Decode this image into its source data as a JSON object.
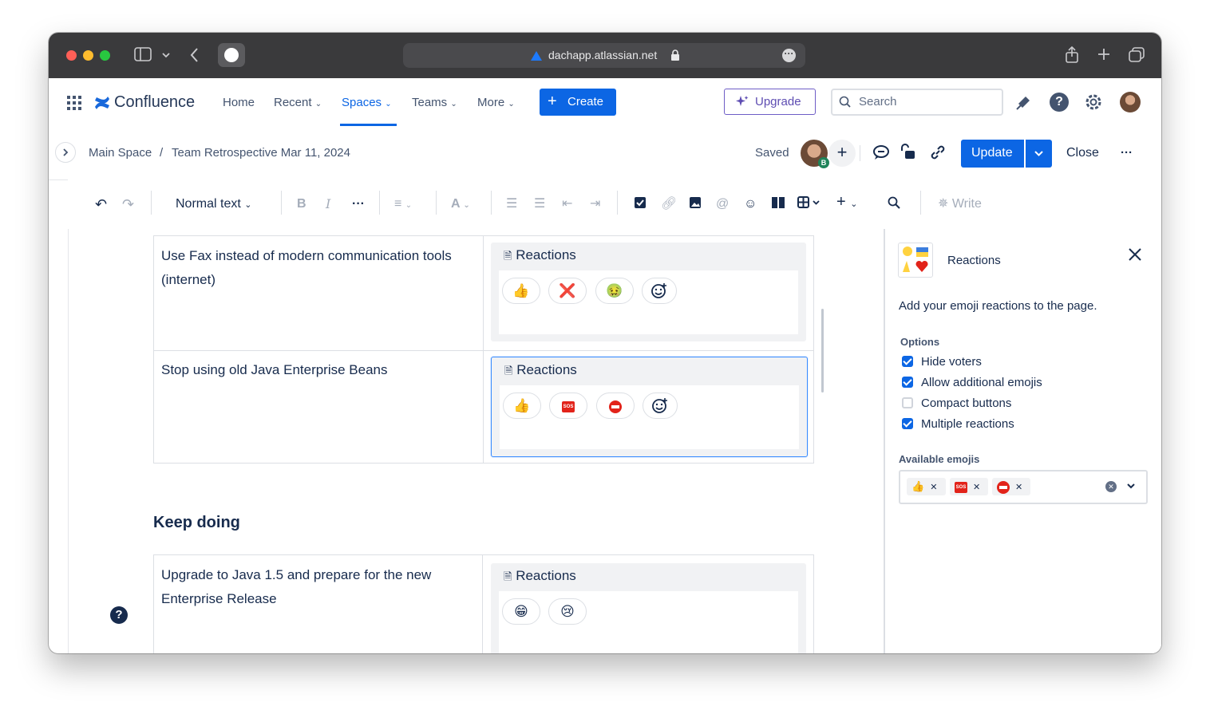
{
  "browser": {
    "url": "dachapp.atlassian.net"
  },
  "topnav": {
    "product": "Confluence",
    "items": [
      {
        "label": "Home"
      },
      {
        "label": "Recent"
      },
      {
        "label": "Spaces"
      },
      {
        "label": "Teams"
      },
      {
        "label": "More"
      }
    ],
    "create_label": "Create",
    "upgrade_label": "Upgrade",
    "search_placeholder": "Search"
  },
  "pagebar": {
    "breadcrumb": [
      "Main Space",
      "/",
      "Team Retrospective Mar 11, 2024"
    ],
    "status": "Saved",
    "avatar_badge": "B",
    "update_label": "Update",
    "close_label": "Close"
  },
  "toolbar": {
    "text_style": "Normal text",
    "write_label": "Write"
  },
  "content": {
    "rows_top": [
      {
        "text": "Use Fax instead of modern communication tools (internet)",
        "macro_title": "Reactions",
        "reactions": [
          "👍",
          "❌",
          "🤢"
        ]
      },
      {
        "text": "Stop using old Java Enterprise Beans",
        "macro_title": "Reactions",
        "reactions": [
          "👍",
          "SOS",
          "⛔"
        ]
      }
    ],
    "section_heading": "Keep doing",
    "rows_bottom": [
      {
        "text": "Upgrade to Java 1.5 and prepare for the new Enterprise Release",
        "macro_title": "Reactions",
        "reactions": [
          "😁",
          "😢"
        ]
      }
    ]
  },
  "panel": {
    "title": "Reactions",
    "description": "Add your emoji reactions to the page.",
    "options_label": "Options",
    "options": [
      {
        "label": "Hide voters",
        "checked": true
      },
      {
        "label": "Allow additional emojis",
        "checked": true
      },
      {
        "label": "Compact buttons",
        "checked": false
      },
      {
        "label": "Multiple reactions",
        "checked": true
      }
    ],
    "available_label": "Available emojis",
    "available_emojis": [
      "👍",
      "SOS",
      "⛔"
    ]
  },
  "colors": {
    "accent": "#0c66e4",
    "upgrade": "#5e4db2",
    "text": "#172b4d"
  }
}
